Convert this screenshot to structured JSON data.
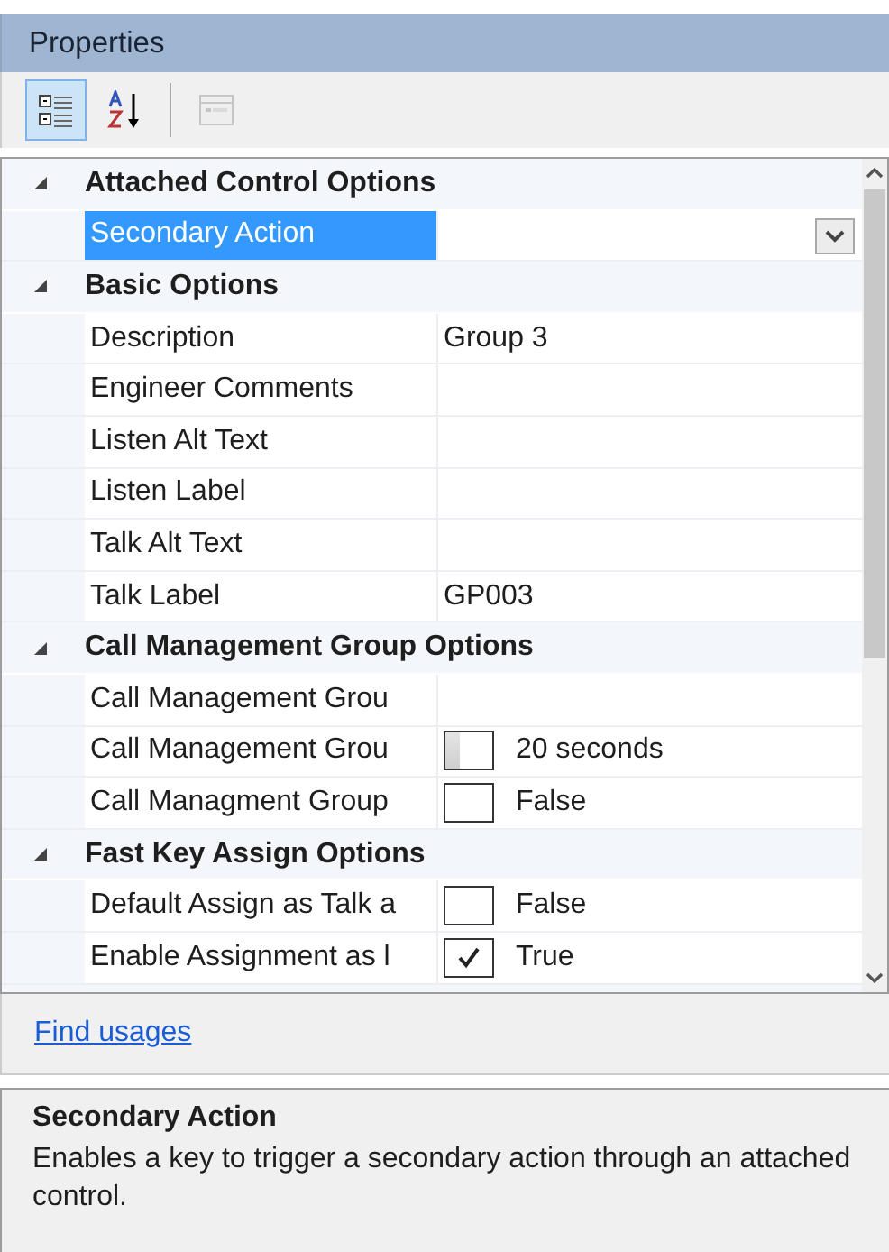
{
  "title": "Properties",
  "toolbar": [
    {
      "kind": "categorized",
      "selected": true,
      "disabled": false
    },
    {
      "kind": "alphabetical",
      "selected": false,
      "disabled": false
    },
    {
      "kind": "pages",
      "selected": false,
      "disabled": true
    }
  ],
  "categories": [
    {
      "name": "Attached Control Options",
      "expanded": true,
      "properties": [
        {
          "name": "Secondary Action",
          "kind": "dropdown",
          "selected": true
        }
      ]
    },
    {
      "name": "Basic Options",
      "expanded": true,
      "properties": [
        {
          "name": "Description",
          "kind": "text",
          "value": "Group 3",
          "selected": false
        },
        {
          "name": "Engineer Comments",
          "kind": "text",
          "selected": false
        },
        {
          "name": "Listen Alt Text",
          "kind": "text",
          "selected": false
        },
        {
          "name": "Listen Label",
          "kind": "text",
          "selected": false
        },
        {
          "name": "Talk Alt Text",
          "kind": "text",
          "selected": false
        },
        {
          "name": "Talk Label",
          "kind": "text",
          "value": "GP003",
          "selected": false
        }
      ]
    },
    {
      "name": "Call Management Group Options",
      "expanded": true,
      "properties": [
        {
          "name": "Call Management Grou",
          "kind": "text",
          "selected": false
        },
        {
          "name": "Call Management Grou",
          "kind": "slider",
          "level": 0.3,
          "value": "20 seconds",
          "selected": false
        },
        {
          "name": "Call Managment Group",
          "kind": "checkbox",
          "checked": false,
          "value": "False",
          "selected": false
        }
      ]
    },
    {
      "name": "Fast Key Assign Options",
      "expanded": true,
      "properties": [
        {
          "name": "Default Assign as Talk a",
          "kind": "checkbox",
          "checked": false,
          "value": "False",
          "selected": false
        },
        {
          "name": "Enable Assignment as l",
          "kind": "checkbox",
          "checked": true,
          "value": "True",
          "selected": false
        }
      ]
    }
  ],
  "commands": [
    {
      "label": "Find usages"
    }
  ],
  "description": {
    "title": "Secondary Action",
    "text": "Enables a key to trigger a secondary action through an attached control."
  }
}
